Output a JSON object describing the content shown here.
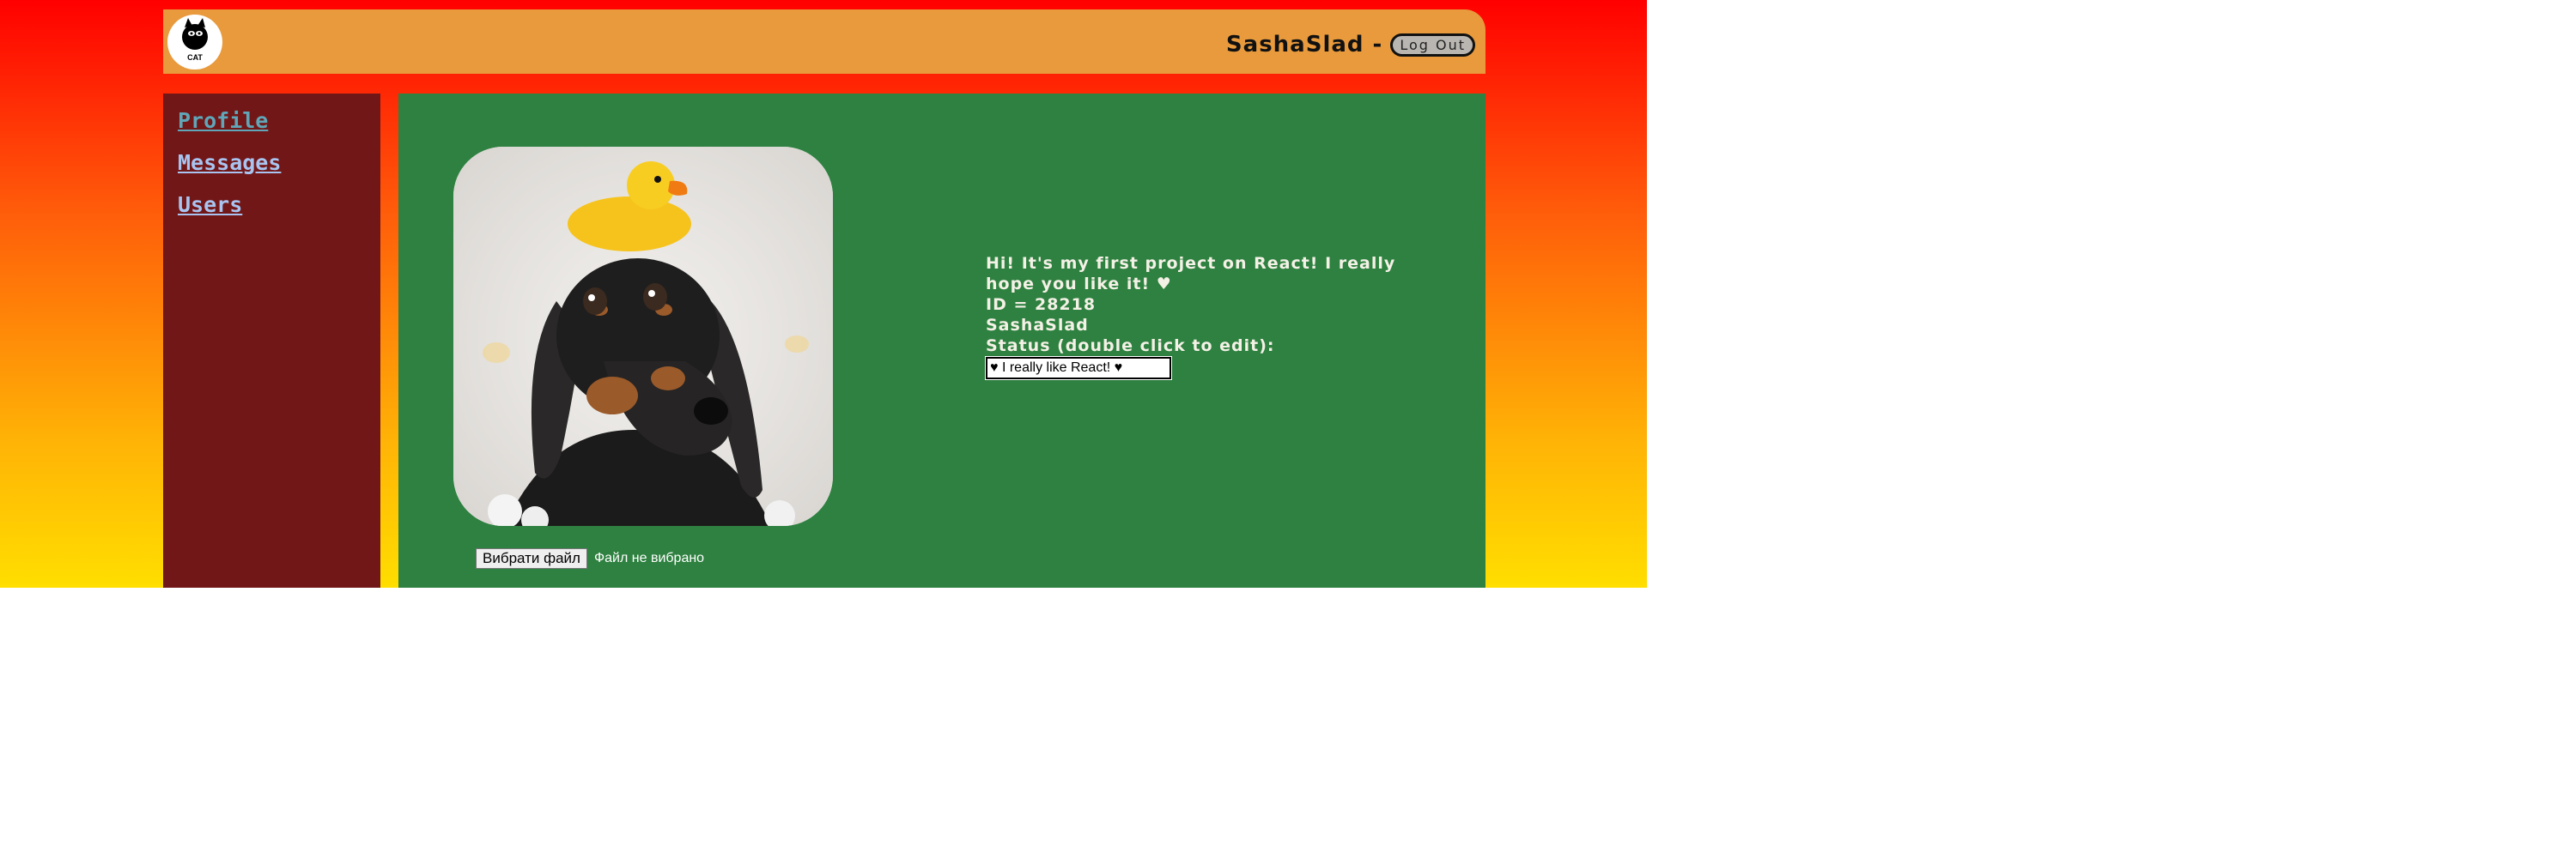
{
  "header": {
    "logo_text": "CAT",
    "username": "SashaSlad",
    "separator": "-",
    "logout_label": "Log Out"
  },
  "sidebar": {
    "items": [
      {
        "label": "Profile",
        "active": true
      },
      {
        "label": "Messages",
        "active": false
      },
      {
        "label": "Users",
        "active": false
      }
    ]
  },
  "profile": {
    "about": "Hi! It's my first project on React! I really hope you like it! ♥",
    "id_line": "ID = 28218",
    "name": "SashaSlad",
    "status_label": "Status (double click to edit):",
    "status_value": "♥ I really like React! ♥",
    "file_button_label": "Вибрати файл",
    "file_status": "Файл не вибрано"
  },
  "colors": {
    "header_bg": "#e89a3d",
    "sidebar_bg": "#721717",
    "content_bg": "#2e8140",
    "link_color": "#a8c4f0",
    "active_link_color": "#5fa6b8"
  }
}
